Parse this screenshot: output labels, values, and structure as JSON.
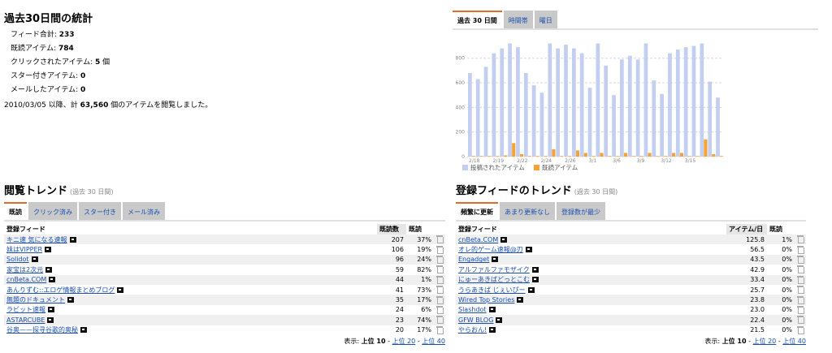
{
  "stats": {
    "title": "過去30日間の統計",
    "lines": [
      {
        "label": "フィード合計: ",
        "value": "233",
        "suffix": ""
      },
      {
        "label": "既読アイテム: ",
        "value": "784",
        "suffix": ""
      },
      {
        "label": "クリックされたアイテム: ",
        "value": "5",
        "suffix": " 個"
      },
      {
        "label": "スター付きアイテム: ",
        "value": "0",
        "suffix": ""
      },
      {
        "label": "メールしたアイテム: ",
        "value": "0",
        "suffix": ""
      }
    ],
    "summary_prefix": "2010/03/05 以降、計 ",
    "summary_value": "63,560",
    "summary_suffix": " 個のアイテムを閲覧しました。"
  },
  "chart_tabs": [
    "過去 30 日間",
    "時間帯",
    "曜日"
  ],
  "chart_data": {
    "type": "bar",
    "categories": [
      "2/18",
      "",
      "",
      "2/19",
      "",
      "",
      "2/22",
      "",
      "",
      "2/24",
      "",
      "",
      "2/26",
      "",
      "",
      "3/1",
      "",
      "",
      "3/6",
      "",
      "",
      "3/9",
      "",
      "",
      "3/12",
      "",
      "",
      "3/15",
      "",
      ""
    ],
    "series": [
      {
        "name": "投稿されたアイテム",
        "values": [
          680,
          630,
          730,
          840,
          880,
          920,
          890,
          680,
          580,
          520,
          920,
          880,
          910,
          880,
          840,
          560,
          920,
          740,
          500,
          790,
          820,
          790,
          920,
          620,
          510,
          840,
          870,
          890,
          900,
          920,
          610,
          480
        ]
      },
      {
        "name": "既読アイテム",
        "values": [
          5,
          5,
          5,
          5,
          10,
          110,
          20,
          5,
          5,
          5,
          60,
          5,
          5,
          50,
          30,
          5,
          30,
          5,
          5,
          30,
          5,
          5,
          30,
          5,
          5,
          30,
          30,
          5,
          5,
          140,
          20,
          5
        ]
      }
    ],
    "yticks": [
      0,
      200,
      400,
      600,
      800
    ],
    "ylim": [
      0,
      950
    ],
    "colors": {
      "posted": "#c3cff0",
      "read": "#f6a234"
    }
  },
  "read_trend": {
    "title": "閲覧トレンド",
    "subtitle": "(過去 30 日間)",
    "tabs": [
      "既読",
      "クリック済み",
      "スター付き",
      "メール済み"
    ],
    "headers": {
      "feed": "登録フィード",
      "count": "既読数",
      "pct": "既読"
    },
    "rows": [
      {
        "feed": "キニ速 気になる速報",
        "count": "207",
        "pct": "37%"
      },
      {
        "feed": "妹はVIPPER",
        "count": "106",
        "pct": "19%"
      },
      {
        "feed": "Solidot",
        "count": "96",
        "pct": "24%"
      },
      {
        "feed": "家宝は2次元",
        "count": "59",
        "pct": "82%"
      },
      {
        "feed": "cnBeta.COM",
        "count": "44",
        "pct": "1%"
      },
      {
        "feed": "あんりずむ::エロゲ情報まとめブログ",
        "count": "41",
        "pct": "73%"
      },
      {
        "feed": "無題のドキュメント",
        "count": "35",
        "pct": "17%"
      },
      {
        "feed": "ラビット速報",
        "count": "24",
        "pct": "6%"
      },
      {
        "feed": "ASTARCUBE",
        "count": "23",
        "pct": "74%"
      },
      {
        "feed": "谷奥——探寻谷歌的奥秘",
        "count": "20",
        "pct": "17%"
      }
    ],
    "pager": {
      "prefix": "表示: ",
      "top10": "上位 10",
      "sep1": " - ",
      "top20": "上位 20",
      "sep2": " - ",
      "top40": "上位 40"
    }
  },
  "feed_trend": {
    "title": "登録フィードのトレンド",
    "subtitle": "(過去 30 日間)",
    "tabs": [
      "頻繁に更新",
      "あまり更新なし",
      "登録数が最少"
    ],
    "headers": {
      "feed": "登録フィード",
      "count": "アイテム/日",
      "pct": "既読"
    },
    "rows": [
      {
        "feed": "cnBeta.COM",
        "count": "125.8",
        "pct": "1%"
      },
      {
        "feed": "オレ的ゲーム速報@刃",
        "count": "56.5",
        "pct": "0%"
      },
      {
        "feed": "Engadget",
        "count": "43.5",
        "pct": "0%"
      },
      {
        "feed": "アルファルファモザイク",
        "count": "42.9",
        "pct": "0%"
      },
      {
        "feed": "にゅーあきばどっとこむ",
        "count": "33.4",
        "pct": "0%"
      },
      {
        "feed": "うらあきば じぇいぴー",
        "count": "25.7",
        "pct": "0%"
      },
      {
        "feed": "Wired Top Stories",
        "count": "23.8",
        "pct": "0%"
      },
      {
        "feed": "Slashdot",
        "count": "23.0",
        "pct": "0%"
      },
      {
        "feed": "GFW BLOG",
        "count": "22.4",
        "pct": "0%"
      },
      {
        "feed": "やらおん!",
        "count": "21.5",
        "pct": "0%"
      }
    ],
    "pager": {
      "prefix": "表示: ",
      "top10": "上位 10",
      "sep1": " - ",
      "top20": "上位 20",
      "sep2": " - ",
      "top40": "上位 40"
    }
  }
}
